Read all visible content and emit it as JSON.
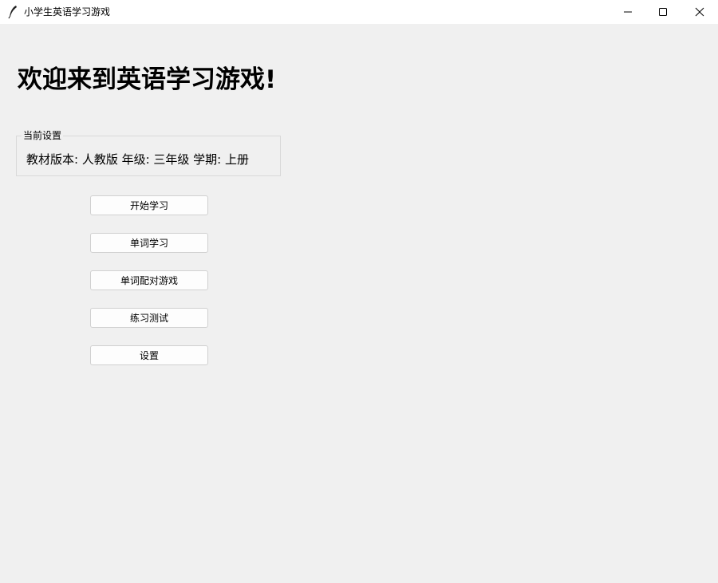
{
  "window": {
    "title": "小学生英语学习游戏"
  },
  "main": {
    "welcome": "欢迎来到英语学习游戏!",
    "settings": {
      "legend": "当前设置",
      "info": "教材版本: 人教版  年级: 三年级  学期: 上册"
    },
    "buttons": {
      "start": "开始学习",
      "word_study": "单词学习",
      "match_game": "单词配对游戏",
      "practice_test": "练习测试",
      "settings": "设置"
    }
  }
}
